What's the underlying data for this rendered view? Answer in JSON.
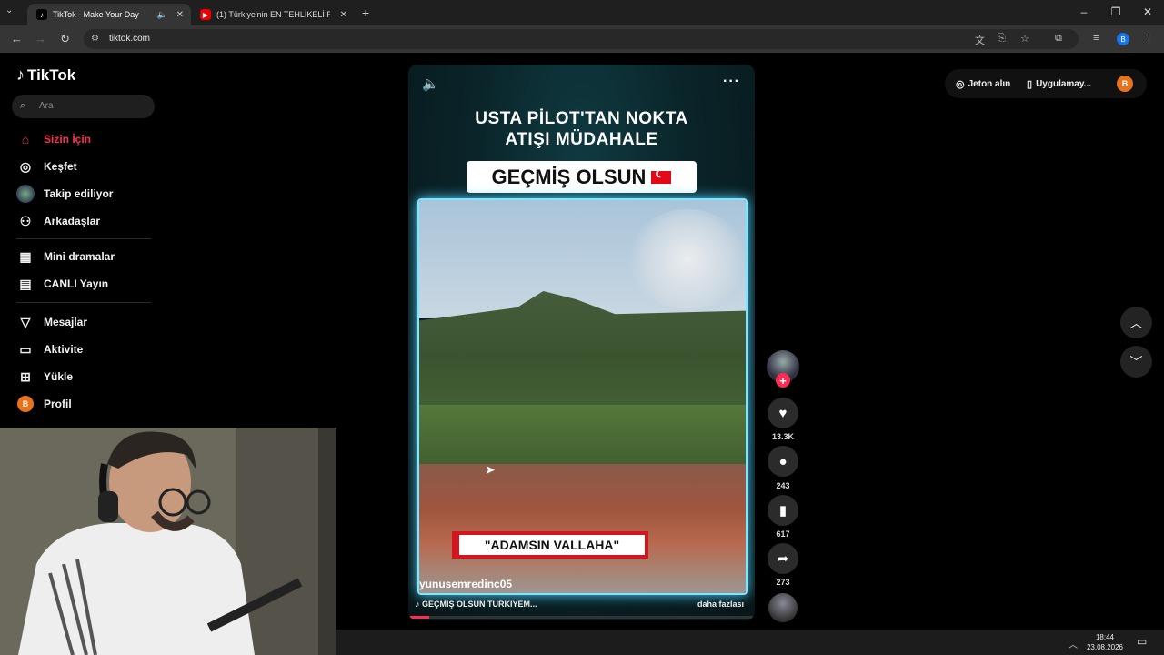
{
  "browser": {
    "tabs": [
      {
        "title": "TikTok - Make Your Day",
        "active": true
      },
      {
        "title": "(1) Türkiye'nin EN TEHLİKELİ Ra",
        "active": false
      }
    ],
    "url": "tiktok.com"
  },
  "sidebar": {
    "logo": "TikTok",
    "search_placeholder": "Ara",
    "items": [
      {
        "label": "Sizin İçin",
        "icon": "home-icon"
      },
      {
        "label": "Keşfet",
        "icon": "compass-icon"
      },
      {
        "label": "Takip ediliyor",
        "icon": "following-avatar-icon"
      },
      {
        "label": "Arkadaşlar",
        "icon": "friends-icon"
      },
      {
        "label": "Mini dramalar",
        "icon": "film-icon"
      },
      {
        "label": "CANLI Yayın",
        "icon": "live-icon"
      },
      {
        "label": "Mesajlar",
        "icon": "send-icon"
      },
      {
        "label": "Aktivite",
        "icon": "activity-icon"
      },
      {
        "label": "Yükle",
        "icon": "upload-icon"
      },
      {
        "label": "Profil",
        "icon": "profile-icon"
      }
    ]
  },
  "header": {
    "coins_label": "Jeton alın",
    "app_label": "Uygulamay...",
    "profile_initial": "B"
  },
  "video": {
    "title_line1": "USTA PİLOT'TAN NOKTA",
    "title_line2": "ATIŞI MÜDAHALE",
    "banner": "GEÇMİŞ OLSUN",
    "caption": "\"ADAMSIN VALLAHA\"",
    "author": "yunusemredinc05",
    "description": "GEÇMİŞ OLSUN TÜRKİYEM...",
    "more": "daha fazlası",
    "progress": 0.06
  },
  "actions": {
    "likes": "13.3K",
    "comments": "243",
    "saves": "617",
    "shares": "273"
  },
  "taskbar": {
    "time": "18:44",
    "date": "23.08.2026"
  },
  "colors": {
    "accent": "#fe2c55",
    "background": "#000000",
    "frame_glow": "#7ee6ff"
  }
}
